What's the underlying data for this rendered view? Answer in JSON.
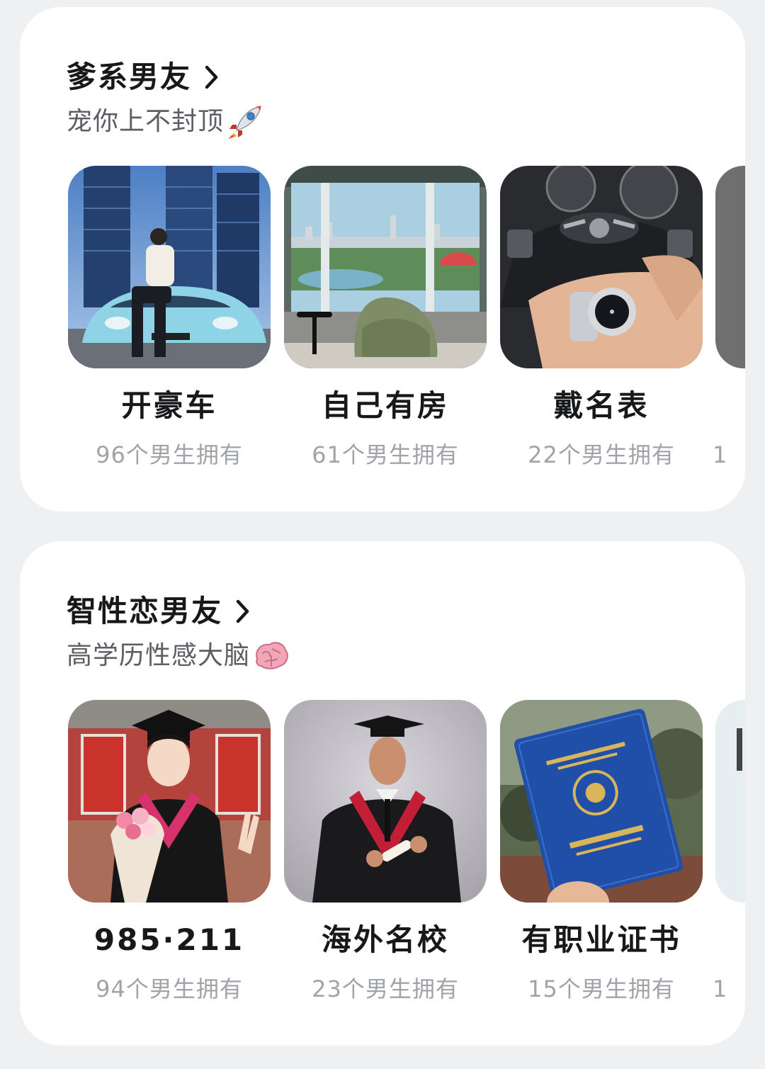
{
  "sections": [
    {
      "title": "爹系男友",
      "subtitle": "宠你上不封顶",
      "subtitle_emoji": "rocket-emoji",
      "items": [
        {
          "label": "开豪车",
          "count": "96个男生拥有",
          "image": "sports-car-photo"
        },
        {
          "label": "自己有房",
          "count": "61个男生拥有",
          "image": "apartment-view-photo"
        },
        {
          "label": "戴名表",
          "count": "22个男生拥有",
          "image": "luxury-watch-photo"
        }
      ],
      "peek_count": "1"
    },
    {
      "title": "智性恋男友",
      "subtitle": "高学历性感大脑",
      "subtitle_emoji": "brain-emoji",
      "items": [
        {
          "label": "985·211",
          "count": "94个男生拥有",
          "image": "graduation-bouquet-photo"
        },
        {
          "label": "海外名校",
          "count": "23个男生拥有",
          "image": "graduation-gown-photo"
        },
        {
          "label": "有职业证书",
          "count": "15个男生拥有",
          "image": "certificate-photo"
        }
      ],
      "peek_count": "1"
    }
  ],
  "colors": {
    "page_background": "#eef0f2",
    "card_background": "#ffffff",
    "title_text": "#17181a",
    "subtitle_text": "#5b5e63",
    "count_text": "#a0a3a8"
  }
}
